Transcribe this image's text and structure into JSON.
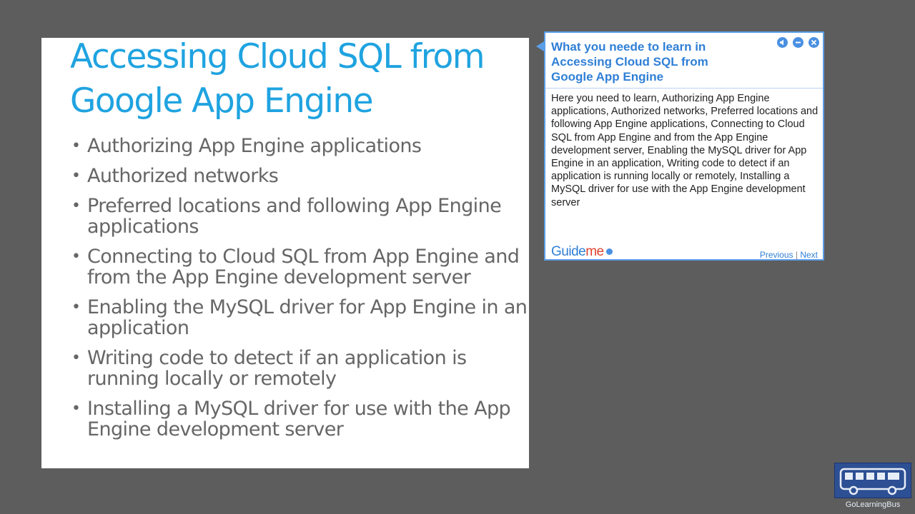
{
  "slide": {
    "title": "Accessing Cloud SQL from Google App Engine",
    "bullets": [
      "Authorizing App Engine applications",
      "Authorized networks",
      "Preferred locations and following App Engine applications",
      "Connecting to Cloud SQL from App Engine and from the App Engine development server",
      "Enabling the MySQL driver for App Engine in an application",
      "Writing code to detect if an application is running locally or remotely",
      "Installing a MySQL driver for use with the App Engine development server"
    ]
  },
  "guide": {
    "heading": "What you neede to learn in Accessing Cloud SQL from Google App Engine",
    "body": "Here you need to learn, Authorizing App Engine applications, Authorized networks, Preferred locations and following App Engine applications, Connecting to Cloud SQL from App Engine and from the App Engine development server, Enabling the MySQL driver for App Engine in an application, Writing code to detect if an application is running locally or remotely, Installing a MySQL driver for use with the App Engine development server",
    "logo_part1": "Guide",
    "logo_part2": "me",
    "previous_label": "Previous",
    "separator": "|",
    "next_label": "Next",
    "controls": [
      "speaker-icon",
      "minimize-icon",
      "close-icon"
    ]
  },
  "brand": {
    "label": "GoLearningBus"
  },
  "colors": {
    "background": "#5d5d5d",
    "title_blue": "#1fa3e0",
    "bullet_gray": "#666666",
    "guide_border": "#5c9ee8",
    "guide_heading": "#2f7fd6",
    "logo_red": "#e0432f",
    "brand_blue": "#2d4f93"
  }
}
